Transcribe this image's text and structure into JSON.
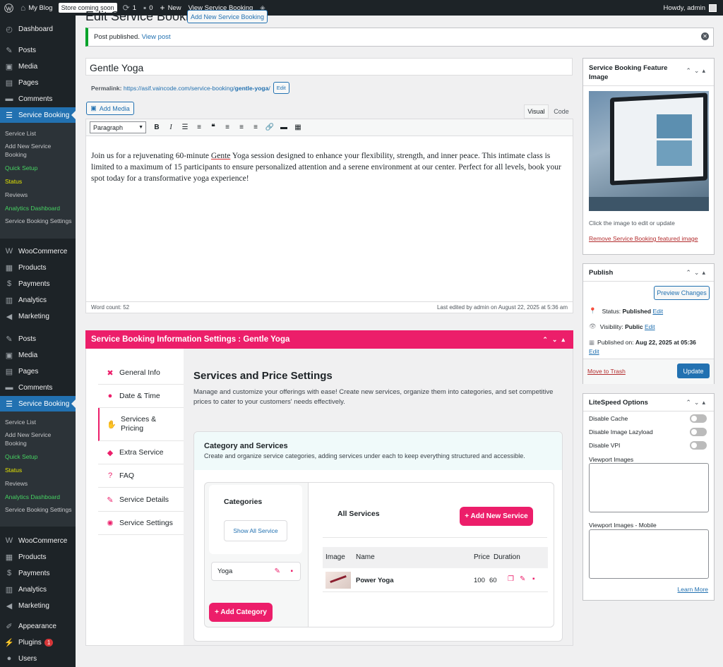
{
  "adminbar": {
    "site": "My Blog",
    "store": "Store coming soon",
    "updates": "1",
    "comments": "0",
    "new": "New",
    "view": "View Service Booking",
    "howdy": "Howdy, admin"
  },
  "sidebar": {
    "top": [
      "Dashboard",
      "Posts",
      "Media",
      "Pages",
      "Comments",
      "Service Booking"
    ],
    "sub1": [
      "Service List",
      "Add New Service Booking",
      "Quick Setup",
      "Status",
      "Reviews",
      "Analytics Dashboard",
      "Service Booking Settings"
    ],
    "mid": [
      "WooCommerce",
      "Products",
      "Payments",
      "Analytics",
      "Marketing",
      "Posts",
      "Media",
      "Pages",
      "Comments",
      "Service Booking"
    ],
    "sub2": [
      "Service List",
      "Add New Service Booking",
      "Quick Setup",
      "Status",
      "Reviews",
      "Analytics Dashboard",
      "Service Booking Settings"
    ],
    "bot": [
      "WooCommerce",
      "Products",
      "Payments",
      "Analytics",
      "Marketing",
      "Appearance",
      "Plugins",
      "Users"
    ],
    "plugins_badge": "1"
  },
  "page": {
    "heading": "Edit Service Booking",
    "add_new": "Add New Service Booking",
    "notice": "Post published.",
    "notice_link": "View post"
  },
  "post": {
    "title": "Gentle Yoga",
    "permalink_label": "Permalink:",
    "permalink_base": "https://asif.vaincode.com/service-booking/",
    "permalink_slug": "gentle-yoga",
    "permalink_end": "/",
    "edit": "Edit"
  },
  "editor": {
    "add_media": "Add Media",
    "tab_visual": "Visual",
    "tab_code": "Code",
    "format": "Paragraph",
    "content_a": "Join us for a rejuvenating 60-minute ",
    "content_misspelled": "Gente",
    "content_b": " Yoga session designed to enhance your flexibility, strength, and inner peace. This intimate class is limited to a maximum of 15 participants to ensure personalized attention and a serene environment at our center. Perfect for all levels, book your spot today for a transformative yoga experience!",
    "word_count": "Word count: 52",
    "last_edited": "Last edited by admin on August 22, 2025 at 5:36 am"
  },
  "sbinfo": {
    "title": "Service Booking Information Settings : Gentle Yoga",
    "nav": [
      "General Info",
      "Date & Time",
      "Services & Pricing",
      "Extra Service",
      "FAQ",
      "Service Details",
      "Service Settings"
    ],
    "heading": "Services and Price Settings",
    "desc": "Manage and customize your offerings with ease! Create new services, organize them into categories, and set competitive prices to cater to your customers' needs effectively.",
    "card_title": "Category and Services",
    "card_desc": "Create and organize service categories, adding services under each to keep everything structured and accessible.",
    "categories": "Categories",
    "show_all": "Show All Service",
    "category_item": "Yoga",
    "add_category": "+ Add Category",
    "all_services": "All Services",
    "add_service": "+ Add New Service",
    "cols": [
      "Image",
      "Name",
      "Price",
      "Duration"
    ],
    "row": {
      "name": "Power Yoga",
      "price": "100",
      "duration": "60"
    }
  },
  "featured": {
    "title": "Service Booking Feature Image",
    "hint": "Click the image to edit or update",
    "remove": "Remove Service Booking featured image"
  },
  "publish": {
    "title": "Publish",
    "preview": "Preview Changes",
    "status_label": "Status:",
    "status": "Published",
    "vis_label": "Visibility:",
    "vis": "Public",
    "pub_label": "Published on:",
    "pub": "Aug 22, 2025 at 05:36",
    "edit": "Edit",
    "trash": "Move to Trash",
    "update": "Update"
  },
  "litespeed": {
    "title": "LiteSpeed Options",
    "opts": [
      "Disable Cache",
      "Disable Image Lazyload",
      "Disable VPI"
    ],
    "vp": "Viewport Images",
    "vpm": "Viewport Images - Mobile",
    "learn": "Learn More"
  },
  "colors": {
    "accent": "#ec1e6a",
    "wp_blue": "#2271b1",
    "sidebar": "#1d2327"
  }
}
